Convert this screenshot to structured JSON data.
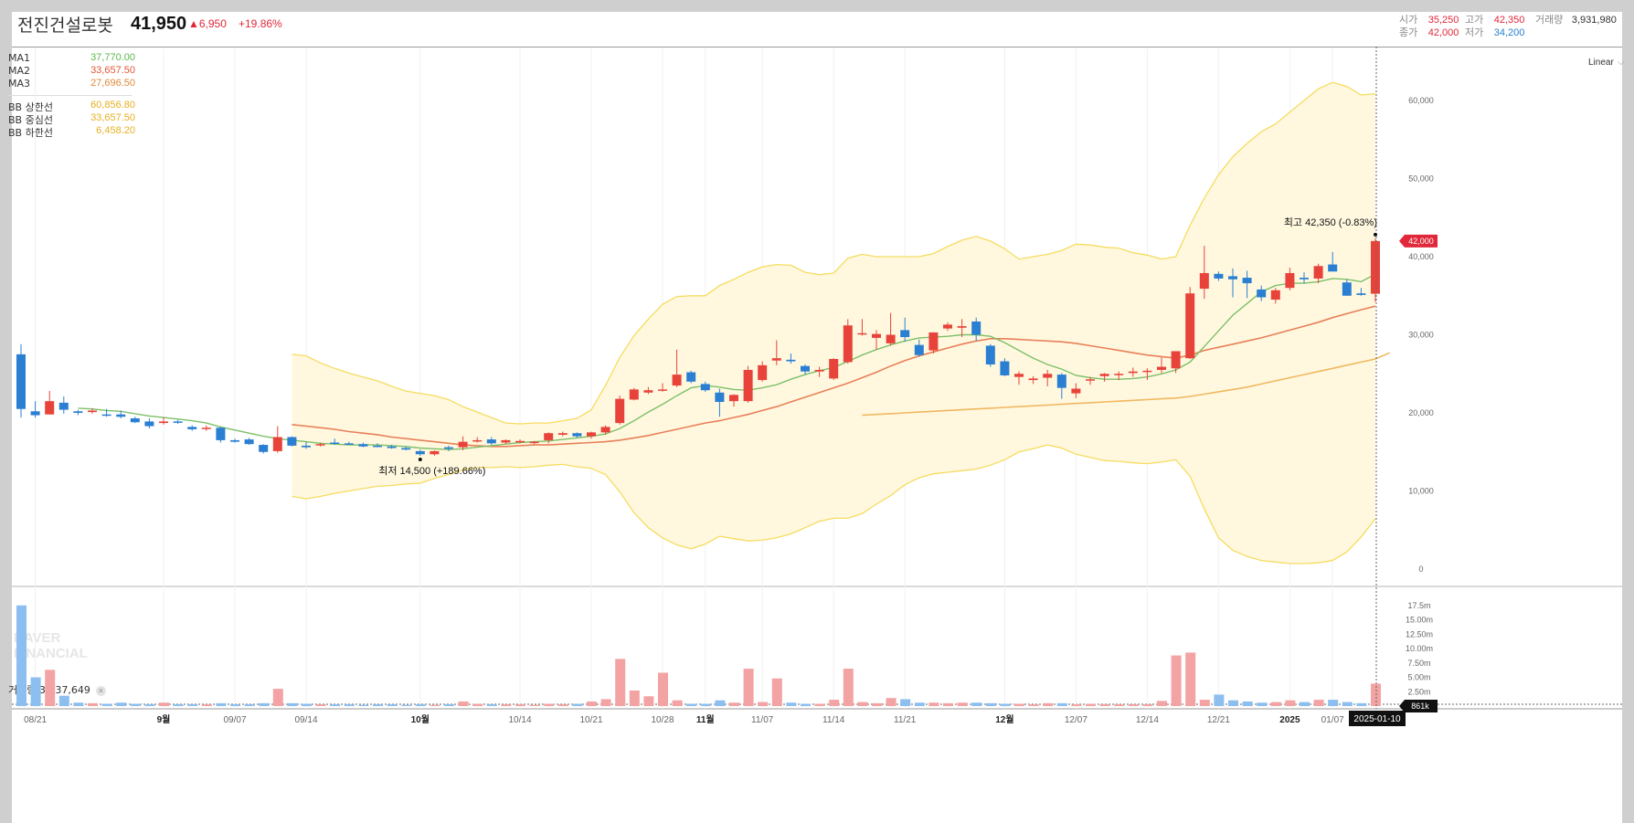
{
  "header": {
    "stock_name": "전진건설로봇",
    "price": "41,950",
    "change": "▲6,950",
    "change_pct": "+19.86%",
    "open_label": "시가",
    "open": "35,250",
    "high_label": "고가",
    "high": "42,350",
    "volume_label": "거래량",
    "volume": "3,931,980",
    "close_label": "종가",
    "close": "42,000",
    "low_label": "저가",
    "low": "34,200"
  },
  "legend": {
    "ma1_label": "MA1",
    "ma1": "37,770.00",
    "ma2_label": "MA2",
    "ma2": "33,657.50",
    "ma3_label": "MA3",
    "ma3": "27,696.50",
    "bb_upper_label": "BB 상한선",
    "bb_upper": "60,856.80",
    "bb_mid_label": "BB 중심선",
    "bb_mid": "33,657.50",
    "bb_lower_label": "BB 하한선",
    "bb_lower": "6,458.20"
  },
  "scale_mode": "Linear",
  "watermark": {
    "line1": "NAVER",
    "line2": "FINANCIAL"
  },
  "volume_legend": {
    "label": "거래량",
    "value": "3,837,649"
  },
  "colors": {
    "up": "#e8433a",
    "down": "#2a7fd2",
    "ma1": "#7cc069",
    "ma2": "#e8805a",
    "ma3": "#f0b860",
    "band_fill": "#fff8df",
    "band_line": "#f5dc60",
    "vol_up": "#f3a3a3",
    "vol_down": "#8cbff0"
  },
  "chart_data": {
    "type": "candlestick",
    "price_axis": {
      "min": 0,
      "max": 60000,
      "ticks": [
        "0",
        "10,000",
        "20,000",
        "30,000",
        "40,000",
        "50,000",
        "60,000"
      ],
      "tick_values": [
        0,
        10000,
        20000,
        30000,
        40000,
        50000,
        60000
      ]
    },
    "volume_axis": {
      "ticks": [
        "2.50m",
        "5.00m",
        "7.50m",
        "10.00m",
        "12.50m",
        "15.00m",
        "17.5m"
      ],
      "tick_values": [
        2.5,
        5,
        7.5,
        10,
        12.5,
        15,
        17.5
      ],
      "unit": "m"
    },
    "x_labels": [
      {
        "i": 1,
        "text": "08/21"
      },
      {
        "i": 10,
        "text": "9월"
      },
      {
        "i": 15,
        "text": "09/07"
      },
      {
        "i": 20,
        "text": "09/14"
      },
      {
        "i": 28,
        "text": "10월"
      },
      {
        "i": 35,
        "text": "10/14"
      },
      {
        "i": 40,
        "text": "10/21"
      },
      {
        "i": 45,
        "text": "10/28"
      },
      {
        "i": 48,
        "text": "11월"
      },
      {
        "i": 52,
        "text": "11/07"
      },
      {
        "i": 57,
        "text": "11/14"
      },
      {
        "i": 62,
        "text": "11/21"
      },
      {
        "i": 69,
        "text": "12월"
      },
      {
        "i": 74,
        "text": "12/07"
      },
      {
        "i": 79,
        "text": "12/14"
      },
      {
        "i": 84,
        "text": "12/21"
      },
      {
        "i": 89,
        "text": "2025"
      },
      {
        "i": 92,
        "text": "01/07"
      }
    ],
    "cursor_date": "2025-01-10",
    "cursor_price_tag": "42,000",
    "cursor_volume_tag": "861k",
    "high_annotation": {
      "i": 95,
      "price": 42350,
      "text": "최고 42,350 (-0.83%)"
    },
    "low_annotation": {
      "i": 28,
      "price": 14500,
      "text": "최저 14,500 (+189.66%)"
    },
    "candles": [
      [
        27500,
        28800,
        19400,
        20500,
        17.5
      ],
      [
        20200,
        21500,
        19400,
        19700,
        5.0
      ],
      [
        19800,
        22800,
        19800,
        21500,
        6.3
      ],
      [
        21300,
        22100,
        19900,
        20400,
        1.8
      ],
      [
        20200,
        20400,
        19700,
        20000,
        0.6
      ],
      [
        20100,
        20600,
        19900,
        20300,
        0.5
      ],
      [
        19800,
        20500,
        19500,
        19700,
        0.4
      ],
      [
        19800,
        20300,
        19300,
        19500,
        0.6
      ],
      [
        19300,
        19500,
        18700,
        18800,
        0.4
      ],
      [
        18900,
        19300,
        18000,
        18300,
        0.3
      ],
      [
        18700,
        19400,
        18500,
        18900,
        0.6
      ],
      [
        18900,
        19100,
        18600,
        18800,
        0.3
      ],
      [
        18200,
        18400,
        17700,
        17900,
        0.3
      ],
      [
        18000,
        18400,
        17700,
        18100,
        0.3
      ],
      [
        18100,
        18200,
        16200,
        16500,
        0.5
      ],
      [
        16500,
        16700,
        16200,
        16300,
        0.3
      ],
      [
        16600,
        16800,
        15900,
        16000,
        0.3
      ],
      [
        15900,
        16000,
        14800,
        15000,
        0.5
      ],
      [
        15100,
        18300,
        14900,
        16900,
        3.0
      ],
      [
        16900,
        17000,
        15700,
        15800,
        0.5
      ],
      [
        15800,
        16300,
        15400,
        15600,
        0.4
      ],
      [
        15900,
        16200,
        15700,
        16000,
        0.3
      ],
      [
        16200,
        16700,
        15900,
        16100,
        0.3
      ],
      [
        16100,
        16300,
        15900,
        16000,
        0.3
      ],
      [
        16000,
        16200,
        15600,
        15700,
        0.2
      ],
      [
        15800,
        16100,
        15600,
        15700,
        0.3
      ],
      [
        15700,
        15900,
        15400,
        15500,
        0.3
      ],
      [
        15500,
        15700,
        15200,
        15300,
        0.2
      ],
      [
        15100,
        15300,
        14500,
        14700,
        0.3
      ],
      [
        14700,
        15200,
        14500,
        15100,
        0.2
      ],
      [
        15600,
        15800,
        15100,
        15400,
        0.3
      ],
      [
        15600,
        17000,
        15200,
        16300,
        0.8
      ],
      [
        16500,
        16900,
        16200,
        16500,
        0.4
      ],
      [
        16600,
        16900,
        15900,
        16100,
        0.3
      ],
      [
        16200,
        16600,
        16000,
        16500,
        0.3
      ],
      [
        16300,
        16600,
        16100,
        16400,
        0.3
      ],
      [
        16200,
        16400,
        16000,
        16300,
        0.2
      ],
      [
        16500,
        17500,
        16100,
        17400,
        0.4
      ],
      [
        17200,
        17600,
        17000,
        17400,
        0.3
      ],
      [
        17400,
        17500,
        16800,
        17000,
        0.4
      ],
      [
        17000,
        17600,
        16700,
        17500,
        0.8
      ],
      [
        17500,
        18400,
        17200,
        18200,
        1.2
      ],
      [
        18700,
        22200,
        18500,
        21800,
        8.2
      ],
      [
        21700,
        23200,
        21600,
        23000,
        2.7
      ],
      [
        22600,
        23300,
        22400,
        22900,
        1.7
      ],
      [
        22900,
        23800,
        22700,
        23000,
        5.8
      ],
      [
        23500,
        28100,
        23300,
        24900,
        1.0
      ],
      [
        25200,
        25400,
        23800,
        24000,
        0.4
      ],
      [
        23700,
        24000,
        22700,
        22900,
        0.4
      ],
      [
        22600,
        23100,
        19500,
        21400,
        1.0
      ],
      [
        21500,
        22400,
        20800,
        22300,
        0.6
      ],
      [
        21500,
        26000,
        21300,
        25500,
        6.5
      ],
      [
        24200,
        26600,
        24000,
        26100,
        0.7
      ],
      [
        26700,
        29300,
        26100,
        27000,
        4.8
      ],
      [
        26800,
        27600,
        26300,
        26600,
        0.6
      ],
      [
        26000,
        26200,
        24900,
        25300,
        0.4
      ],
      [
        25300,
        25900,
        24600,
        25500,
        0.4
      ],
      [
        24400,
        27000,
        24200,
        26900,
        1.1
      ],
      [
        26500,
        32000,
        26300,
        31200,
        6.5
      ],
      [
        30100,
        32000,
        29900,
        30200,
        0.7
      ],
      [
        29600,
        30600,
        28100,
        30100,
        0.5
      ],
      [
        28900,
        32800,
        28600,
        30000,
        1.4
      ],
      [
        30600,
        32200,
        29100,
        29700,
        1.2
      ],
      [
        28700,
        29400,
        27200,
        27400,
        0.6
      ],
      [
        28000,
        30300,
        27600,
        30300,
        0.6
      ],
      [
        30800,
        31600,
        30500,
        31300,
        0.5
      ],
      [
        30900,
        32000,
        29700,
        31100,
        0.6
      ],
      [
        31700,
        32200,
        29200,
        30000,
        0.6
      ],
      [
        28600,
        28800,
        25900,
        26200,
        0.5
      ],
      [
        26600,
        27000,
        24700,
        24800,
        0.4
      ],
      [
        24600,
        25300,
        23600,
        25000,
        0.4
      ],
      [
        24200,
        24700,
        23700,
        24400,
        0.3
      ],
      [
        24500,
        25500,
        23400,
        25000,
        0.5
      ],
      [
        24900,
        25100,
        21800,
        23200,
        0.5
      ],
      [
        22500,
        23800,
        21900,
        23100,
        0.3
      ],
      [
        24200,
        24600,
        23600,
        24300,
        0.4
      ],
      [
        24700,
        25100,
        24000,
        25000,
        0.3
      ],
      [
        24900,
        25300,
        24200,
        25000,
        0.3
      ],
      [
        25100,
        25800,
        24600,
        25300,
        0.3
      ],
      [
        25300,
        25700,
        24200,
        25400,
        0.3
      ],
      [
        25500,
        27100,
        25100,
        25900,
        0.9
      ],
      [
        25700,
        27700,
        25100,
        27900,
        8.8
      ],
      [
        27000,
        36100,
        26900,
        35300,
        9.3
      ],
      [
        35900,
        41400,
        34600,
        37900,
        1.1
      ],
      [
        37800,
        38100,
        36900,
        37200,
        2.0
      ],
      [
        37500,
        38500,
        34800,
        37100,
        1.0
      ],
      [
        37300,
        38200,
        34700,
        36600,
        0.8
      ],
      [
        35800,
        36300,
        34300,
        34800,
        0.6
      ],
      [
        34500,
        36000,
        34000,
        35700,
        0.7
      ],
      [
        36000,
        38600,
        35700,
        37900,
        1.0
      ],
      [
        37300,
        38000,
        36600,
        37100,
        0.7
      ],
      [
        37200,
        39100,
        36600,
        38800,
        1.1
      ],
      [
        39000,
        40600,
        38100,
        38100,
        1.1
      ],
      [
        36700,
        37100,
        35000,
        35000,
        0.7
      ],
      [
        35300,
        36000,
        35000,
        35100,
        0.5
      ],
      [
        35250,
        42350,
        34200,
        42000,
        3.9
      ]
    ],
    "ma1": [
      null,
      null,
      null,
      null,
      20600,
      20500,
      20300,
      20200,
      19900,
      19600,
      19400,
      19200,
      19000,
      18700,
      18200,
      17800,
      17400,
      17000,
      16700,
      16500,
      16300,
      16100,
      16000,
      15900,
      15900,
      15900,
      15800,
      15700,
      15500,
      15400,
      15300,
      15400,
      15600,
      15800,
      16000,
      16200,
      16300,
      16400,
      16600,
      16800,
      17000,
      17300,
      18000,
      19000,
      20100,
      21100,
      22200,
      23200,
      23500,
      23300,
      23000,
      22900,
      23200,
      23600,
      24300,
      24900,
      25400,
      25800,
      26600,
      27400,
      28100,
      28700,
      29200,
      29600,
      29700,
      29800,
      30000,
      30000,
      29800,
      29000,
      28000,
      27000,
      26200,
      25600,
      24800,
      24500,
      24300,
      24300,
      24400,
      24600,
      25000,
      25500,
      26500,
      28500,
      30500,
      32500,
      34000,
      35500,
      36300,
      36600,
      36600,
      36800,
      37200,
      37100,
      36800,
      37770
    ],
    "ma2": [
      null,
      null,
      null,
      null,
      null,
      null,
      null,
      null,
      null,
      null,
      null,
      null,
      null,
      null,
      null,
      null,
      null,
      null,
      null,
      18500,
      18300,
      18100,
      17900,
      17600,
      17400,
      17200,
      16900,
      16700,
      16500,
      16300,
      16100,
      15900,
      15800,
      15700,
      15700,
      15800,
      15900,
      15900,
      16000,
      16100,
      16200,
      16300,
      16500,
      16800,
      17100,
      17500,
      17900,
      18300,
      18700,
      19000,
      19400,
      19800,
      20300,
      20800,
      21400,
      22000,
      22600,
      23200,
      23800,
      24500,
      25200,
      26000,
      26700,
      27300,
      27800,
      28300,
      28800,
      29200,
      29500,
      29500,
      29400,
      29300,
      29200,
      29100,
      28900,
      28600,
      28300,
      28000,
      27700,
      27400,
      27200,
      27000,
      27400,
      28000,
      28400,
      28800,
      29200,
      29600,
      30100,
      30600,
      31100,
      31600,
      32200,
      32700,
      33200,
      33657.5
    ],
    "ma3": [
      null,
      null,
      null,
      null,
      null,
      null,
      null,
      null,
      null,
      null,
      null,
      null,
      null,
      null,
      null,
      null,
      null,
      null,
      null,
      null,
      null,
      null,
      null,
      null,
      null,
      null,
      null,
      null,
      null,
      null,
      null,
      null,
      null,
      null,
      null,
      null,
      null,
      null,
      null,
      null,
      null,
      null,
      null,
      null,
      null,
      null,
      null,
      null,
      null,
      null,
      null,
      null,
      null,
      null,
      null,
      null,
      null,
      null,
      null,
      19700,
      19800,
      19900,
      20000,
      20100,
      20200,
      20300,
      20400,
      20500,
      20600,
      20700,
      20800,
      20900,
      21000,
      21100,
      21200,
      21300,
      21400,
      21500,
      21600,
      21700,
      21800,
      21900,
      22100,
      22400,
      22700,
      23000,
      23300,
      23700,
      24100,
      24500,
      24900,
      25300,
      25700,
      26100,
      26500,
      26900,
      27696.5
    ],
    "bb_upper": [
      null,
      null,
      null,
      null,
      null,
      null,
      null,
      null,
      null,
      null,
      null,
      null,
      null,
      null,
      null,
      null,
      null,
      null,
      null,
      27500,
      27300,
      26400,
      25700,
      25100,
      24600,
      24100,
      23400,
      22800,
      22500,
      22200,
      21700,
      20800,
      20100,
      19400,
      18700,
      18600,
      18700,
      18700,
      19000,
      19300,
      20400,
      23500,
      27100,
      29900,
      32000,
      33900,
      34900,
      35000,
      35000,
      36300,
      37100,
      38000,
      38700,
      39000,
      38900,
      38000,
      37700,
      37900,
      39800,
      40300,
      40000,
      40000,
      40000,
      40000,
      40400,
      41300,
      42100,
      42600,
      42000,
      41000,
      39700,
      40000,
      40300,
      40800,
      41600,
      41500,
      41200,
      41100,
      40500,
      40200,
      39700,
      40000,
      44000,
      47500,
      50500,
      52800,
      54500,
      56000,
      57000,
      58500,
      60000,
      61500,
      62300,
      61800,
      60700,
      60856.8
    ],
    "bb_lower": [
      null,
      null,
      null,
      null,
      null,
      null,
      null,
      null,
      null,
      null,
      null,
      null,
      null,
      null,
      null,
      null,
      null,
      null,
      null,
      9300,
      9000,
      9300,
      9700,
      10000,
      10300,
      10600,
      10700,
      10900,
      11000,
      11600,
      12100,
      12700,
      13000,
      13000,
      13100,
      13000,
      13100,
      13300,
      13400,
      13100,
      12900,
      12100,
      9900,
      7200,
      5300,
      4000,
      3100,
      2600,
      3200,
      4200,
      3900,
      3600,
      3700,
      4000,
      4500,
      5300,
      6100,
      6500,
      6500,
      7100,
      8300,
      9400,
      10800,
      11700,
      12200,
      12400,
      12600,
      12800,
      13300,
      14000,
      15000,
      15400,
      15900,
      15500,
      14700,
      14300,
      13900,
      13800,
      13600,
      13500,
      13700,
      14000,
      11900,
      7700,
      4000,
      2400,
      1600,
      1100,
      900,
      700,
      700,
      800,
      1100,
      2200,
      4100,
      6458.2
    ]
  }
}
